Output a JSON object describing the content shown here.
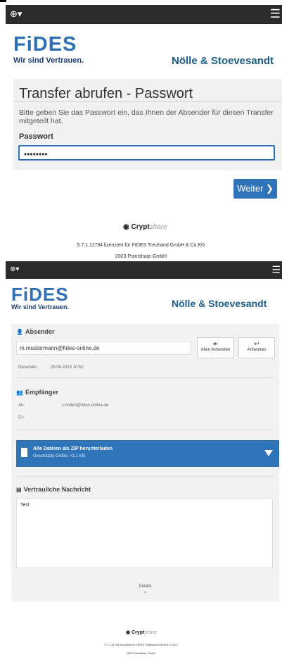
{
  "topbar": {
    "globe_icon": "globe-icon",
    "menu_icon": "hamburger-icon"
  },
  "brand": {
    "fides": "FiDES",
    "tagline": "Wir sind Vertrauen.",
    "partner": "Nölle & Stoevesandt"
  },
  "password_form": {
    "title": "Transfer abrufen - Passwort",
    "description": "Bitte geben Sie das Passwort ein, das Ihnen der Absender für diesen Transfer mitgeteilt hat.",
    "label": "Passwort",
    "value": "••••••••",
    "next_label": "Weiter ❯"
  },
  "footer": {
    "product_crypt": "Crypt",
    "product_share": "share",
    "license": "5.7.1.11794 lizenziert für FIDES Treuhand GmbH & Co.KG",
    "copyright": "2023 Pointsharp GmbH"
  },
  "transfer": {
    "sender_title": "Absender",
    "sender_email": "m.mustermann@fides-online.de",
    "reply_all_label": "Allen Antworten",
    "reply_label": "Antworten",
    "sent_label": "Gesendet:",
    "sent_value": "25.04.2023 10:52",
    "recipients_title": "Empfänger",
    "to_label": "An:",
    "to_value": "c.holten@fides-online.de",
    "cc_label": "Cc:",
    "download_label": "Alle Dateien als ZIP herunterladen",
    "download_size": "Geschätzte Größe: <1.1 KB",
    "message_title": "Vertrauliche Nachricht",
    "message_text": "Test",
    "details_label": "Details"
  }
}
